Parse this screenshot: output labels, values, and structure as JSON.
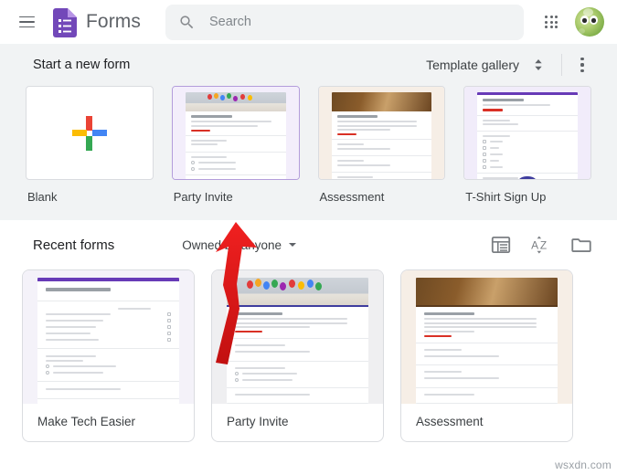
{
  "header": {
    "menu_icon": "hamburger-icon",
    "logo_icon": "google-forms-logo-icon",
    "brand": "Forms",
    "search": {
      "icon": "search-icon",
      "placeholder": "Search",
      "value": ""
    },
    "apps_icon": "google-apps-grid-icon",
    "avatar_icon": "user-avatar"
  },
  "templates": {
    "title": "Start a new form",
    "gallery_label": "Template gallery",
    "gallery_toggle_icon": "chevron-up-down-icon",
    "more_icon": "more-vert-icon",
    "items": [
      {
        "name": "Blank",
        "thumb": "blank-plus"
      },
      {
        "name": "Party Invite",
        "thumb": "party-invite"
      },
      {
        "name": "Assessment",
        "thumb": "assessment"
      },
      {
        "name": "T-Shirt Sign Up",
        "thumb": "tshirt-sign-up"
      }
    ]
  },
  "recent": {
    "title": "Recent forms",
    "owner_filter": "Owned by anyone",
    "owner_caret_icon": "caret-down-icon",
    "list_view_icon": "list-view-icon",
    "sort_icon": "sort-az-icon",
    "folder_icon": "folder-icon",
    "items": [
      {
        "name": "Make Tech Easier",
        "thumb": "make-tech-easier"
      },
      {
        "name": "Party Invite",
        "thumb": "party-invite"
      },
      {
        "name": "Assessment",
        "thumb": "assessment"
      }
    ]
  },
  "annotation": {
    "arrow_color": "#e01b1b",
    "arrow_icon": "red-arrow-annotation"
  },
  "watermark": "wsxdn.com",
  "colors": {
    "forms_purple": "#7248b9",
    "section_bg": "#f1f3f4",
    "text_primary": "#202124",
    "text_secondary": "#5f6368",
    "border": "#dadce0"
  }
}
